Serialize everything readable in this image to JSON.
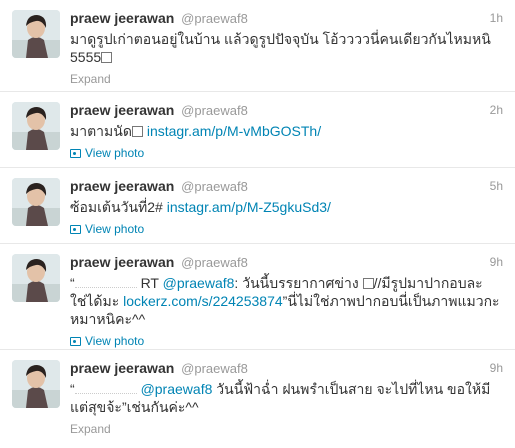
{
  "tweets": [
    {
      "name": "praew jeerawan",
      "handle": "@praewaf8",
      "time": "1h",
      "text_a": "มาดูรูปเก่าตอนอยู่ในบ้าน แล้วดูรูปปัจจุบัน โอ้ววววนี่คนเดียวกันไหมหนิ",
      "text_b": "5555",
      "action": "Expand"
    },
    {
      "name": "praew jeerawan",
      "handle": "@praewaf8",
      "time": "2h",
      "text_a": "มาตามนัด",
      "link": "instagr.am/p/M-vMbGOSTh/",
      "action": "View photo"
    },
    {
      "name": "praew jeerawan",
      "handle": "@praewaf8",
      "time": "5h",
      "text_a": "ซ้อมเต้นวันที่2#",
      "link": "instagr.am/p/M-Z5gkuSd3/",
      "action": "View photo"
    },
    {
      "name": "praew jeerawan",
      "handle": "@praewaf8",
      "time": "9h",
      "quote_open": "“",
      "rt": "RT",
      "mention": "@praewaf8",
      "text_a": ": วันนี้บรรยากาศข่าง",
      "text_b": "//มีรูปมาปากอบละ",
      "text_c": "ใช่ได้มะ",
      "link": "lockerz.com/s/224253874",
      "text_d": "”นี่ไม่ใช่ภาพปากอบนี่เป็นภาพแมวกะ",
      "text_e": "หมาหนิคะ^^",
      "action": "View photo"
    },
    {
      "name": "praew jeerawan",
      "handle": "@praewaf8",
      "time": "9h",
      "quote_open": "“",
      "mention": "@praewaf8",
      "text_a": "วันนี้ฟ้าฉ่ำ ฝนพรำเป็นสาย จะไปที่ไหน ขอให้มี",
      "text_b": "แต่สุขจ้ะ”เช่นกันค่ะ^^",
      "action": "Expand"
    }
  ]
}
